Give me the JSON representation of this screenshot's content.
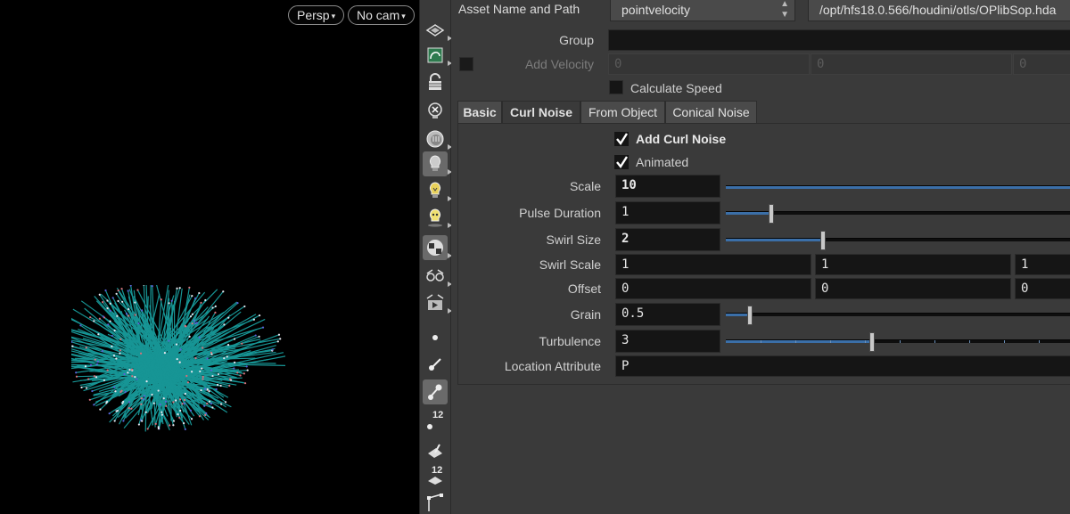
{
  "viewport": {
    "camera_menu": "Persp",
    "cam_menu": "No cam",
    "caret": "▾",
    "point_cloud_color": "#1aa6a6"
  },
  "toolbar": {
    "icons": [
      "display-options-icon",
      "reference-plane-icon",
      "lock-camera-icon",
      "delete-light-icon",
      "headlight-icon",
      "normal-light-icon",
      "high-quality-light-icon",
      "hq-light-shadow-icon",
      "ambient-occlusion-icon",
      "stereo-icon",
      "render-preview-icon",
      "point-display-icon",
      "point-normal-icon",
      "point-velocity-icon",
      "point-numbers-icon",
      "primitive-normal-icon",
      "primitive-numbers-icon",
      "spline-icon"
    ],
    "point_number_badge": "12",
    "prim_number_badge": "12"
  },
  "header": {
    "asset_label": "Asset Name and Path",
    "asset_name": "pointvelocity",
    "asset_path": "/opt/hfs18.0.566/houdini/otls/OPlibSop.hda"
  },
  "group": {
    "label": "Group",
    "value": ""
  },
  "add_velocity": {
    "label": "Add Velocity",
    "values": [
      "0",
      "0",
      "0"
    ]
  },
  "calculate_speed": {
    "label": "Calculate Speed",
    "checked": false
  },
  "tabs": [
    "Basic",
    "Curl Noise",
    "From Object",
    "Conical Noise"
  ],
  "active_tab": "Curl Noise",
  "curl": {
    "add_curl_noise": {
      "label": "Add Curl Noise",
      "checked": true
    },
    "animated": {
      "label": "Animated",
      "checked": true
    },
    "scale": {
      "label": "Scale",
      "value": "10",
      "slider": 1.0
    },
    "pulse_duration": {
      "label": "Pulse Duration",
      "value": "1",
      "slider": 0.13
    },
    "swirl_size": {
      "label": "Swirl Size",
      "value": "2",
      "slider": 0.28
    },
    "swirl_scale": {
      "label": "Swirl Scale",
      "values": [
        "1",
        "1",
        "1"
      ]
    },
    "offset": {
      "label": "Offset",
      "values": [
        "0",
        "0",
        "0"
      ]
    },
    "grain": {
      "label": "Grain",
      "value": "0.5",
      "slider": 0.07
    },
    "turbulence": {
      "label": "Turbulence",
      "value": "3",
      "slider": 0.42
    },
    "location_attribute": {
      "label": "Location Attribute",
      "value": "P"
    }
  },
  "colors": {
    "slider_fill": "#3b6fa8",
    "field_bg": "#151515",
    "pane_bg": "#3a3a3a"
  }
}
